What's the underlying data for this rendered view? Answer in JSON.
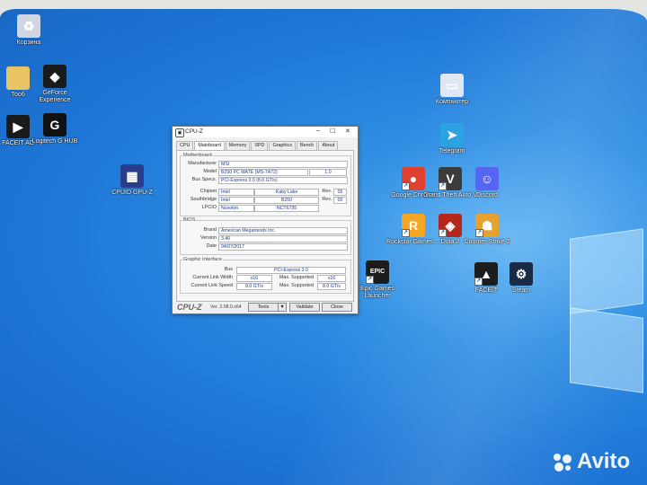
{
  "desktop_icons": [
    {
      "id": "recycle",
      "label": "Корзина",
      "color": "#cfd8e2",
      "glyph": "♻"
    },
    {
      "id": "folder",
      "label": "Тооб",
      "color": "#e9c464",
      "glyph": ""
    },
    {
      "id": "geforce",
      "label": "GeForce Experience",
      "color": "#1b1b1b",
      "glyph": "◆"
    },
    {
      "id": "faceit-ac",
      "label": "FACEIT AC",
      "color": "#1a1a1a",
      "glyph": "▶"
    },
    {
      "id": "logitech",
      "label": "Logitech G HUB",
      "color": "#111111",
      "glyph": "G"
    },
    {
      "id": "cpuid",
      "label": "CPUID GPU-Z",
      "color": "#2a3d8a",
      "glyph": "▦"
    },
    {
      "id": "computer",
      "label": "Компьютер",
      "color": "#dfe8f2",
      "glyph": "▭"
    },
    {
      "id": "telegram",
      "label": "Telegram",
      "color": "#2aa3e0",
      "glyph": "➤"
    },
    {
      "id": "chrome",
      "label": "Google Chrome",
      "color": "#e0402f",
      "glyph": "●"
    },
    {
      "id": "gta",
      "label": "Grand Theft Auto V",
      "color": "#3b3b3b",
      "glyph": "V"
    },
    {
      "id": "discord",
      "label": "Discord",
      "color": "#5865f2",
      "glyph": "☺"
    },
    {
      "id": "rockstar",
      "label": "Rockstar Games ...",
      "color": "#f5a623",
      "glyph": "R"
    },
    {
      "id": "dota",
      "label": "Dota 2",
      "color": "#b5271d",
      "glyph": "◈"
    },
    {
      "id": "cs",
      "label": "Counter-Strike 2",
      "color": "#e6a12e",
      "glyph": "☗"
    },
    {
      "id": "epic",
      "label": "Epic Games Launcher",
      "color": "#1c1c1c",
      "glyph": "EPIC"
    },
    {
      "id": "faceit",
      "label": "FACEIT",
      "color": "#1d1d1d",
      "glyph": "▲"
    },
    {
      "id": "steam",
      "label": "Steam",
      "color": "#1b2a45",
      "glyph": "⚙"
    }
  ],
  "window": {
    "title": "CPU-Z",
    "tabs": [
      "CPU",
      "Mainboard",
      "Memory",
      "SPD",
      "Graphics",
      "Bench",
      "About"
    ],
    "active_tab": "Mainboard",
    "motherboard": {
      "group": "Motherboard",
      "manufacturer_label": "Manufacturer",
      "manufacturer": "MSI",
      "model_label": "Model",
      "model": "B250 PC MATE (MS-7A72)",
      "model_rev": "1.0",
      "busspecs_label": "Bus Specs.",
      "busspecs": "PCI-Express 3.0 (8.0 GT/s)",
      "chipset_label": "Chipset",
      "chipset_vendor": "Intel",
      "chipset_name": "Kaby Lake",
      "chipset_rev_label": "Rev.",
      "chipset_rev": "05",
      "southbridge_label": "Southbridge",
      "sb_vendor": "Intel",
      "sb_name": "B250",
      "sb_rev_label": "Rev.",
      "sb_rev": "00",
      "lpcio_label": "LPCIO",
      "lpcio_vendor": "Nuvoton",
      "lpcio_name": "NCT6795"
    },
    "bios": {
      "group": "BIOS",
      "brand_label": "Brand",
      "brand": "American Megatrends Inc.",
      "version_label": "Version",
      "version": "3.40",
      "date_label": "Date",
      "date": "04/07/2017"
    },
    "graphic": {
      "group": "Graphic Interface",
      "bus_label": "Bus",
      "bus": "PCI-Express 3.0",
      "clw_label": "Current Link Width",
      "clw": "x16",
      "msw_label": "Max. Supported",
      "msw": "x16",
      "cls_label": "Current Link Speed",
      "cls": "8.0 GT/s",
      "mss_label": "Max. Supported",
      "mss": "8.0 GT/s"
    },
    "footer": {
      "logo": "CPU-Z",
      "version": "Ver. 2.08.0.x64",
      "tools": "Tools",
      "validate": "Validate",
      "close": "Close"
    }
  },
  "watermark": "Avito"
}
